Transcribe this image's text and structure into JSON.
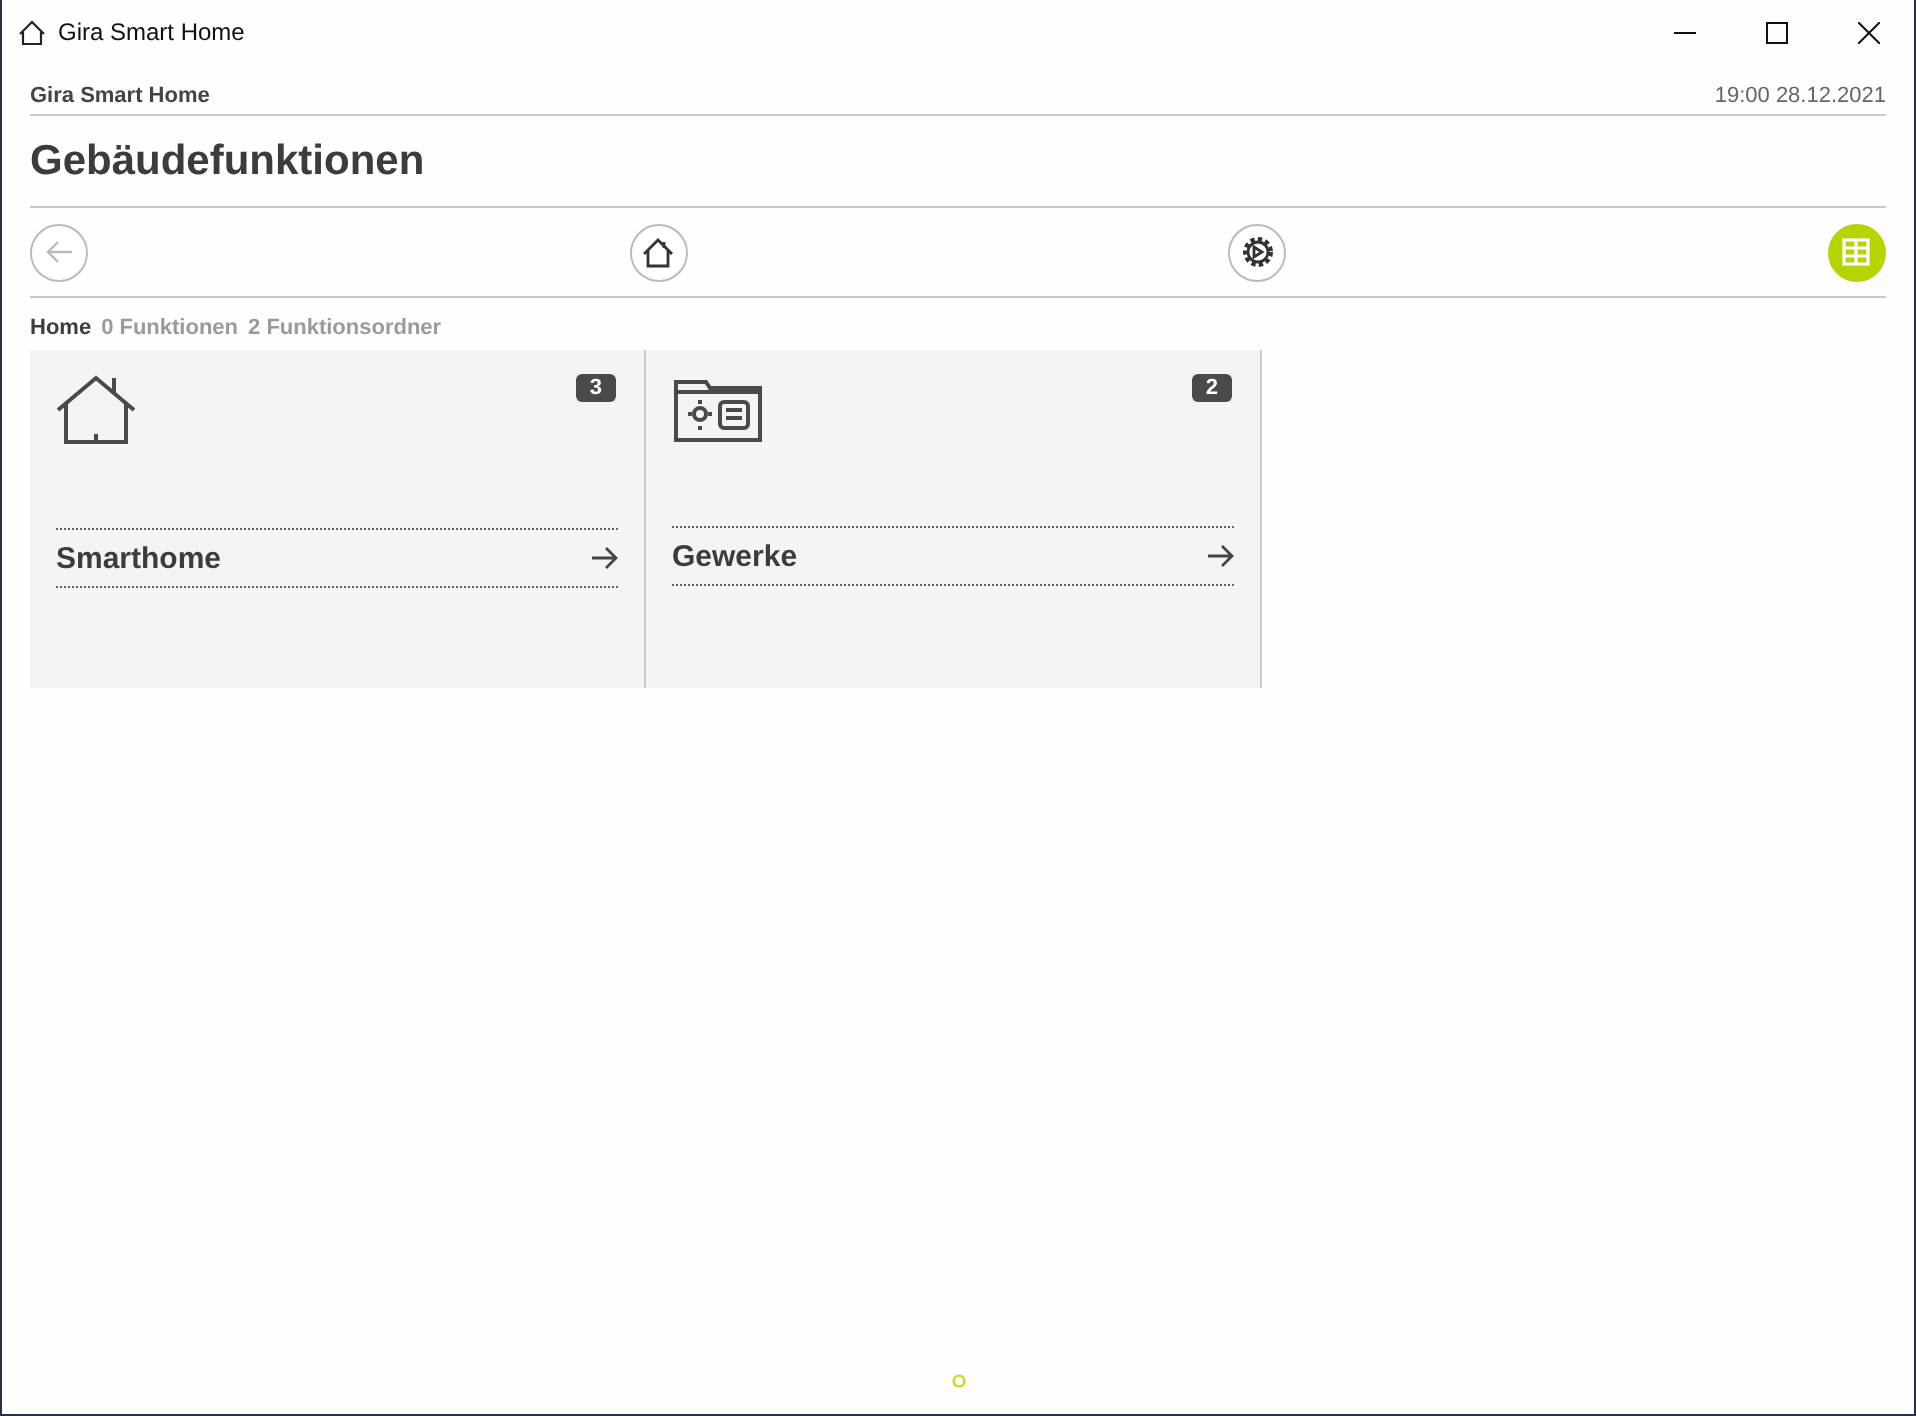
{
  "window": {
    "title": "Gira Smart Home"
  },
  "header": {
    "app_name": "Gira Smart Home",
    "datetime": "19:00 28.12.2021"
  },
  "page_title": "Gebäudefunktionen",
  "toolbar": [
    {
      "kind": "back",
      "selected": false
    },
    {
      "kind": "home",
      "selected": false
    },
    {
      "kind": "scenes",
      "selected": false
    },
    {
      "kind": "grid",
      "selected": true
    }
  ],
  "breadcrumb": [
    {
      "label": "Home",
      "selected": true
    },
    {
      "label": "0 Funktionen",
      "selected": false
    },
    {
      "label": "2 Funktionsordner",
      "selected": false
    }
  ],
  "tiles": [
    {
      "kind": "house",
      "badge": "3",
      "label": "Smarthome"
    },
    {
      "kind": "folder",
      "badge": "2",
      "label": "Gewerke"
    }
  ]
}
